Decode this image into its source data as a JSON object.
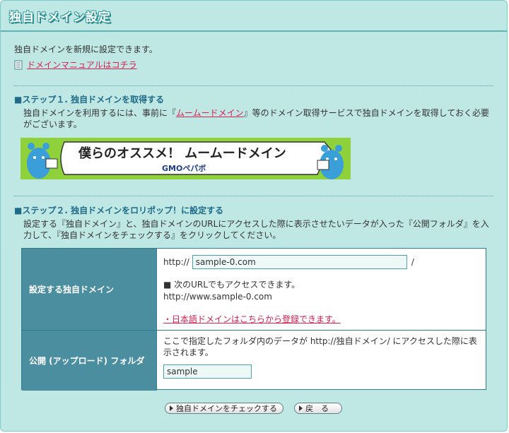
{
  "header": {
    "title": "独自ドメイン設定"
  },
  "intro": {
    "text": "独自ドメインを新規に設定できます。",
    "manual_link": "ドメインマニュアルはコチラ"
  },
  "step1": {
    "title": "■ステップ１. 独自ドメインを取得する",
    "text_before": "独自ドメインを利用するには、事前に『",
    "link": "ムームードメイン",
    "text_after": "』等のドメイン取得サービスで独自ドメインを取得しておく必要がございます。",
    "banner": {
      "headline": "僕らのオススメ！ ムームードメイン",
      "brand": "GMOペパボ",
      "colors": {
        "background": "#8fd13a",
        "mascot": "#3a9fd8"
      }
    }
  },
  "step2": {
    "title": "■ステップ２. 独自ドメインをロリポップ！に設定する",
    "text": "設定する『独自ドメイン』と、独自ドメインのURLにアクセスした際に表示させたいデータが入った『公開フォルダ』を入力して、『独自ドメインをチェックする』をクリックしてください。"
  },
  "form": {
    "domain": {
      "label": "設定する独自ドメイン",
      "prefix": "http://",
      "value": "sample-0.com",
      "suffix": "/",
      "note_title": "■ 次のURLでもアクセスできます。",
      "alt_url": "http://www.sample-0.com",
      "jp_link": "・日本語ドメインはこちらから登録できます。"
    },
    "folder": {
      "label": "公開 (アップロード) フォルダ",
      "desc": "ここで指定したフォルダ内のデータが http://独自ドメイン/ にアクセスした際に表示されます。",
      "value": "sample"
    }
  },
  "buttons": {
    "check": "独自ドメインをチェックする",
    "back": "戻　る"
  },
  "colors": {
    "panel_bg": "#bfe8e5",
    "header_cell": "#4a8ea0",
    "link": "#d6204f",
    "step_title": "#1f6a87"
  }
}
